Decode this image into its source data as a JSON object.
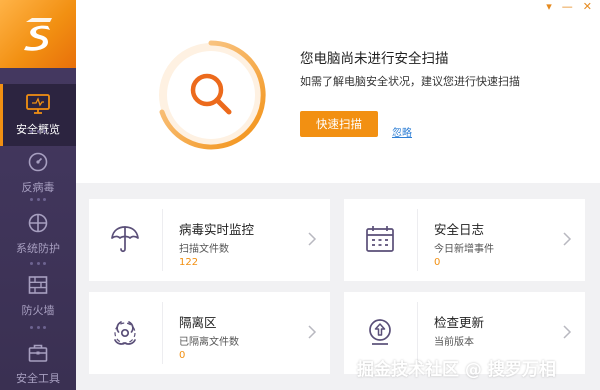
{
  "window": {
    "menu_glyph": "▾",
    "minimize_glyph": "—",
    "close_glyph": "✕"
  },
  "sidebar": {
    "items": [
      {
        "label": "安全概览",
        "icon": "monitor-icon",
        "active": true
      },
      {
        "label": "反病毒",
        "icon": "gauge-icon",
        "active": false
      },
      {
        "label": "系统防护",
        "icon": "crosshair-icon",
        "active": false
      },
      {
        "label": "防火墙",
        "icon": "firewall-icon",
        "active": false
      },
      {
        "label": "安全工具",
        "icon": "toolbox-icon",
        "active": false
      }
    ]
  },
  "hero": {
    "title": "您电脑尚未进行安全扫描",
    "description": "如需了解电脑安全状况，建议您进行快速扫描",
    "scan_button": "快速扫描",
    "ignore_link": "忽略"
  },
  "cards": [
    {
      "title": "病毒实时监控",
      "subtitle": "扫描文件数",
      "value": "122",
      "icon": "umbrella-icon"
    },
    {
      "title": "安全日志",
      "subtitle": "今日新增事件",
      "value": "0",
      "icon": "calendar-icon"
    },
    {
      "title": "隔离区",
      "subtitle": "已隔离文件数",
      "value": "0",
      "icon": "biohazard-icon"
    },
    {
      "title": "检查更新",
      "subtitle": "当前版本",
      "value": "",
      "icon": "update-icon"
    }
  ],
  "watermark": "掘金技术社区 @ 搜罗万相",
  "colors": {
    "accent": "#f29012",
    "sidebar": "#3f345a",
    "link": "#2f7fd5",
    "panel": "#f1f1f3"
  }
}
